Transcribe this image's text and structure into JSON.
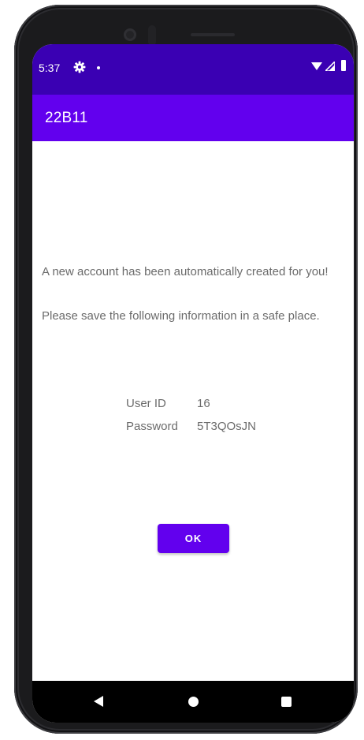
{
  "status_bar": {
    "time": "5:37",
    "icons": [
      "gear-icon",
      "notification-dot-icon",
      "wifi-icon",
      "signal-icon",
      "battery-icon"
    ]
  },
  "app_bar": {
    "title": "22B11"
  },
  "message": {
    "line1": "A new account has been automatically created for you!",
    "line2": "Please save the following information in a safe place."
  },
  "account": {
    "user_id_label": "User ID",
    "user_id_value": "16",
    "password_label": "Password",
    "password_value": "5T3QOsJN"
  },
  "actions": {
    "ok_label": "OK"
  },
  "nav_bar": {
    "icons": [
      "back-icon",
      "home-icon",
      "recents-icon"
    ]
  },
  "colors": {
    "status_bar": "#3a00b3",
    "app_bar": "#6200ee",
    "button": "#6200ee",
    "body_text": "#6b6b6b"
  }
}
